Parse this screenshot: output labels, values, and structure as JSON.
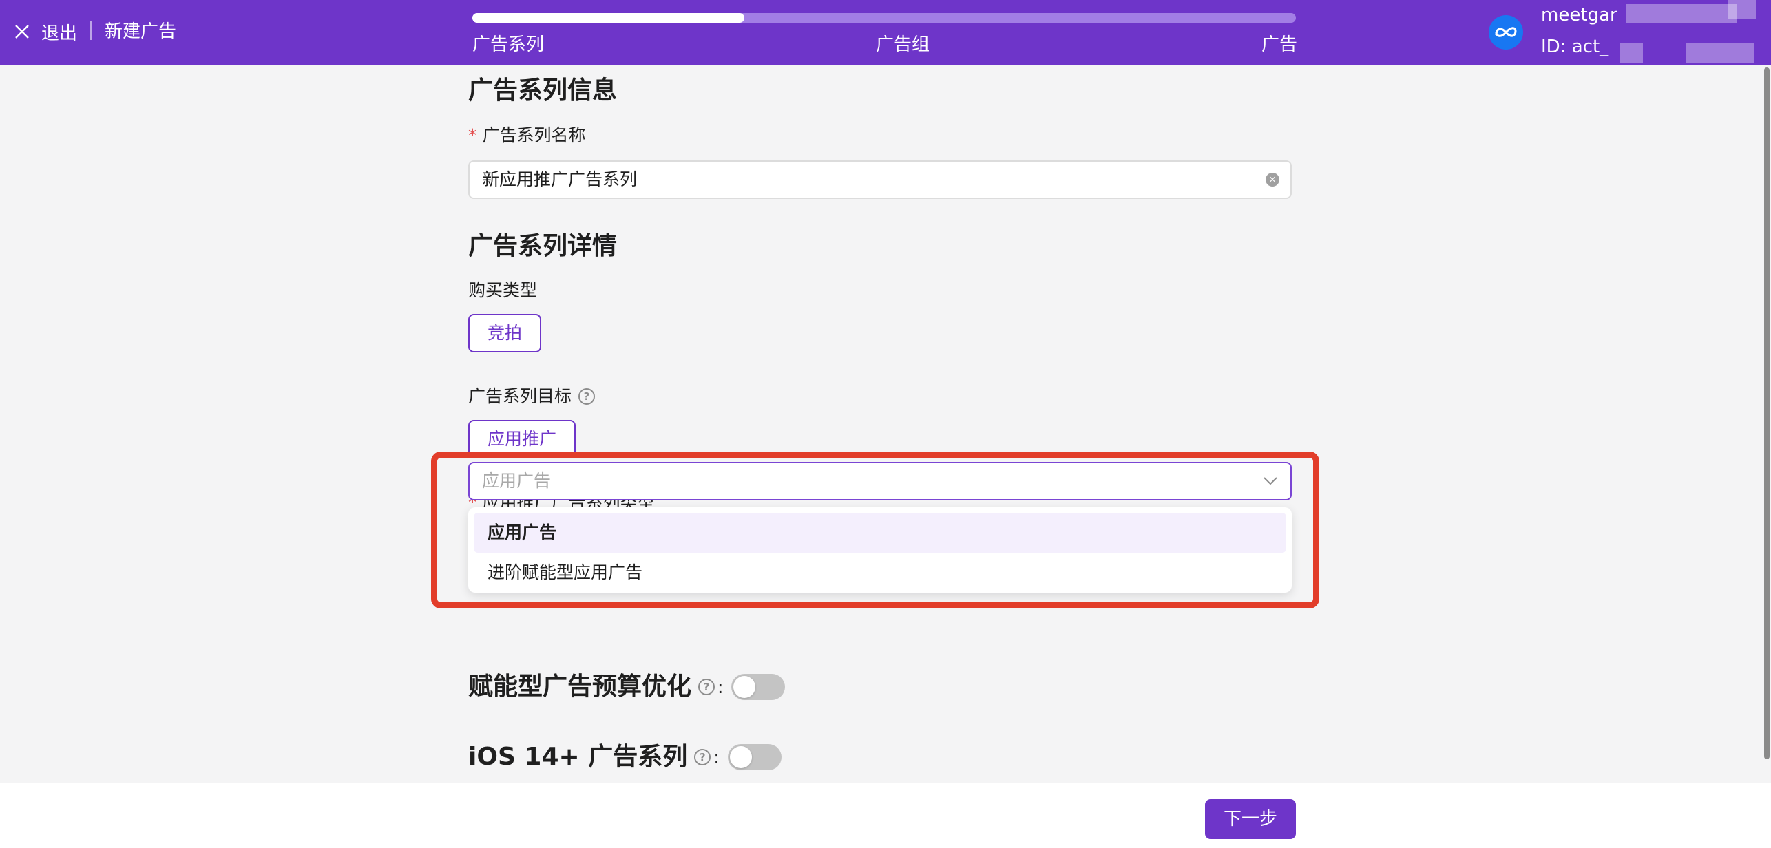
{
  "header": {
    "exit_label": "退出",
    "page_title": "新建广告",
    "progress_fraction": 0.33,
    "steps": [
      {
        "label": "广告系列"
      },
      {
        "label": "广告组"
      },
      {
        "label": "广告"
      }
    ],
    "account_name": "meetgar",
    "account_id": "ID: act_"
  },
  "campaign_info": {
    "heading": "广告系列信息",
    "name_label": "广告系列名称",
    "name_value": "新应用推广广告系列"
  },
  "campaign_details": {
    "heading": "广告系列详情",
    "buying_type_label": "购买类型",
    "buying_type_value": "竞拍",
    "objective_label": "广告系列目标",
    "objective_value": "应用推广",
    "app_type_label": "应用推广广告系列类型",
    "app_type_placeholder": "应用广告",
    "app_type_options": [
      {
        "label": "应用广告",
        "selected": true
      },
      {
        "label": "进阶赋能型应用广告",
        "selected": false
      }
    ]
  },
  "toggles": {
    "budget_optimization_label": "赋能型广告预算优化",
    "ios14_label": "iOS 14+ 广告系列",
    "colon": ":"
  },
  "footer": {
    "next_label": "下一步"
  },
  "colors": {
    "brand": "#6e35c9",
    "highlight": "#e23d2a"
  }
}
